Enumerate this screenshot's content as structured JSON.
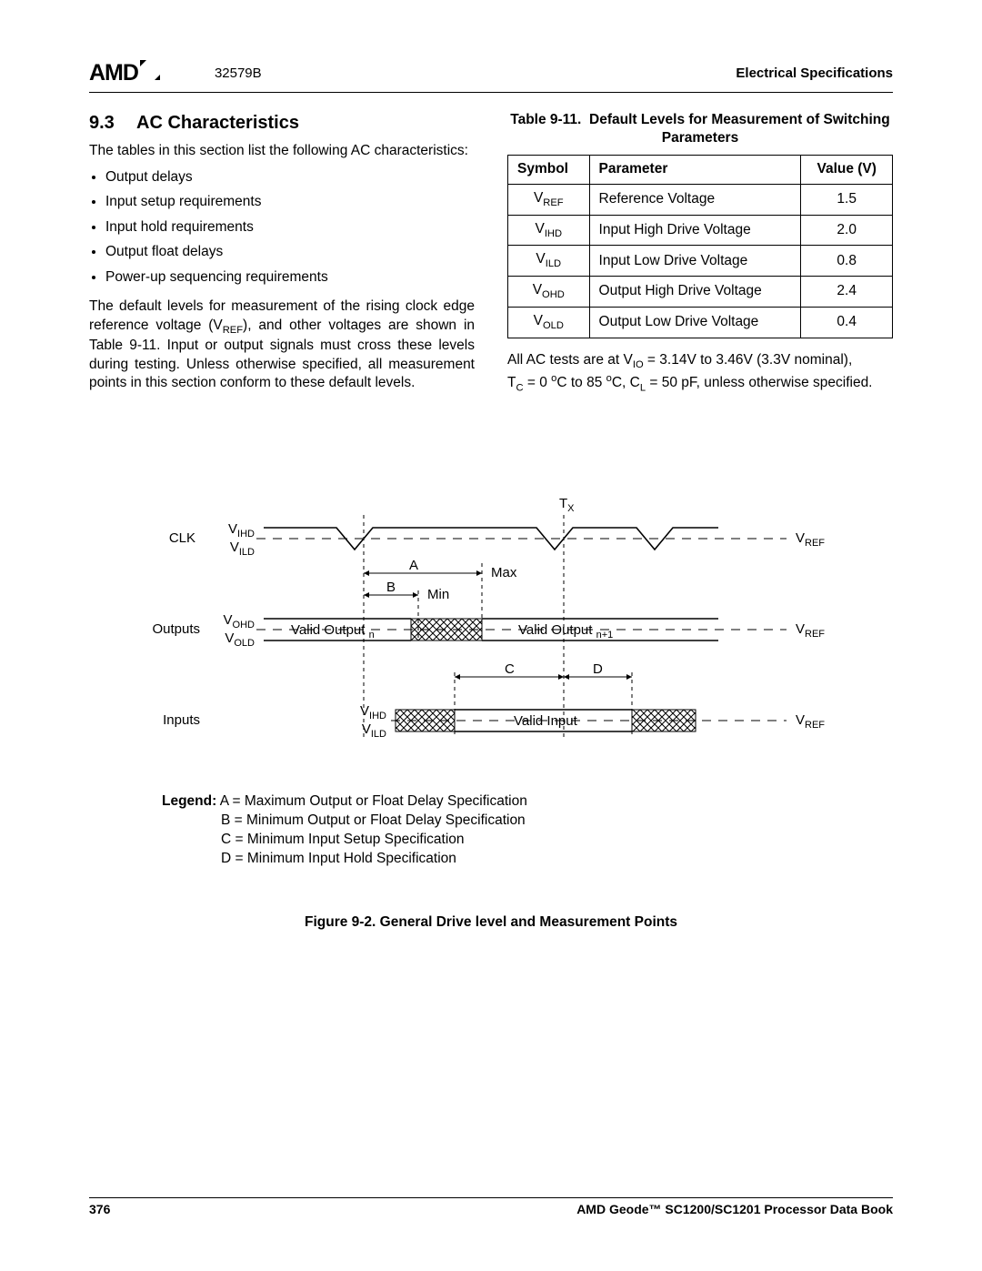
{
  "header": {
    "logo_text": "AMD",
    "doc_number": "32579B",
    "section_name": "Electrical Specifications"
  },
  "section": {
    "number": "9.3",
    "title": "AC Characteristics",
    "intro": "The tables in this section list the following AC characteristics:",
    "bullets": [
      "Output delays",
      "Input setup requirements",
      "Input hold requirements",
      "Output float delays",
      "Power-up sequencing requirements"
    ],
    "para2_a": "The default levels for measurement of the rising clock edge reference voltage (V",
    "para2_sub": "REF",
    "para2_b": "), and other voltages are shown in Table 9-11. Input or output signals must cross these levels during testing. Unless otherwise specified, all measurement points in this section conform to these default levels."
  },
  "table": {
    "caption_a": "Table 9-11.",
    "caption_b": "Default Levels for Measurement of Switching Parameters",
    "col_symbol": "Symbol",
    "col_param": "Parameter",
    "col_value": "Value (V)",
    "rows": [
      {
        "sym_b": "V",
        "sym_s": "REF",
        "param": "Reference Voltage",
        "val": "1.5"
      },
      {
        "sym_b": "V",
        "sym_s": "IHD",
        "param": "Input High Drive Voltage",
        "val": "2.0"
      },
      {
        "sym_b": "V",
        "sym_s": "ILD",
        "param": "Input Low Drive Voltage",
        "val": "0.8"
      },
      {
        "sym_b": "V",
        "sym_s": "OHD",
        "param": "Output High Drive Voltage",
        "val": "2.4"
      },
      {
        "sym_b": "V",
        "sym_s": "OLD",
        "param": "Output Low Drive Voltage",
        "val": "0.4"
      }
    ]
  },
  "ac_note": {
    "l1_a": "All AC tests are at V",
    "l1_s1": "IO",
    "l1_b": " = 3.14V to 3.46V (3.3V nominal),",
    "l2_a": "T",
    "l2_s1": "C",
    "l2_b": " = 0 ",
    "l2_sup1": "o",
    "l2_c": "C to 85 ",
    "l2_sup2": "o",
    "l2_d": "C, C",
    "l2_s2": "L",
    "l2_e": " = 50 pF, unless otherwise specified."
  },
  "figure": {
    "tx": "T",
    "tx_sub": "X",
    "clk": "CLK",
    "vihd": "V",
    "vihd_s": "IHD",
    "vild": "V",
    "vild_s": "ILD",
    "vref": "V",
    "vref_s": "REF",
    "a": "A",
    "b": "B",
    "max": "Max",
    "min": "Min",
    "outputs": "Outputs",
    "vohd": "V",
    "vohd_s": "OHD",
    "vold": "V",
    "vold_s": "OLD",
    "valid_out_n_a": "Valid Output ",
    "valid_out_n_s": "n",
    "valid_out_n1_a": "Valid Output ",
    "valid_out_n1_s": "n+1",
    "c": "C",
    "d": "D",
    "inputs": "Inputs",
    "valid_input": "Valid Input"
  },
  "legend": {
    "label": "Legend:",
    "a": "A = Maximum Output or Float Delay Specification",
    "b": "B = Minimum Output or Float Delay Specification",
    "c": "C = Minimum Input Setup Specification",
    "d": "D = Minimum Input Hold Specification"
  },
  "fig_caption": "Figure 9-2.  General Drive level and Measurement Points",
  "footer": {
    "page": "376",
    "book": "AMD Geode™ SC1200/SC1201 Processor Data Book"
  }
}
